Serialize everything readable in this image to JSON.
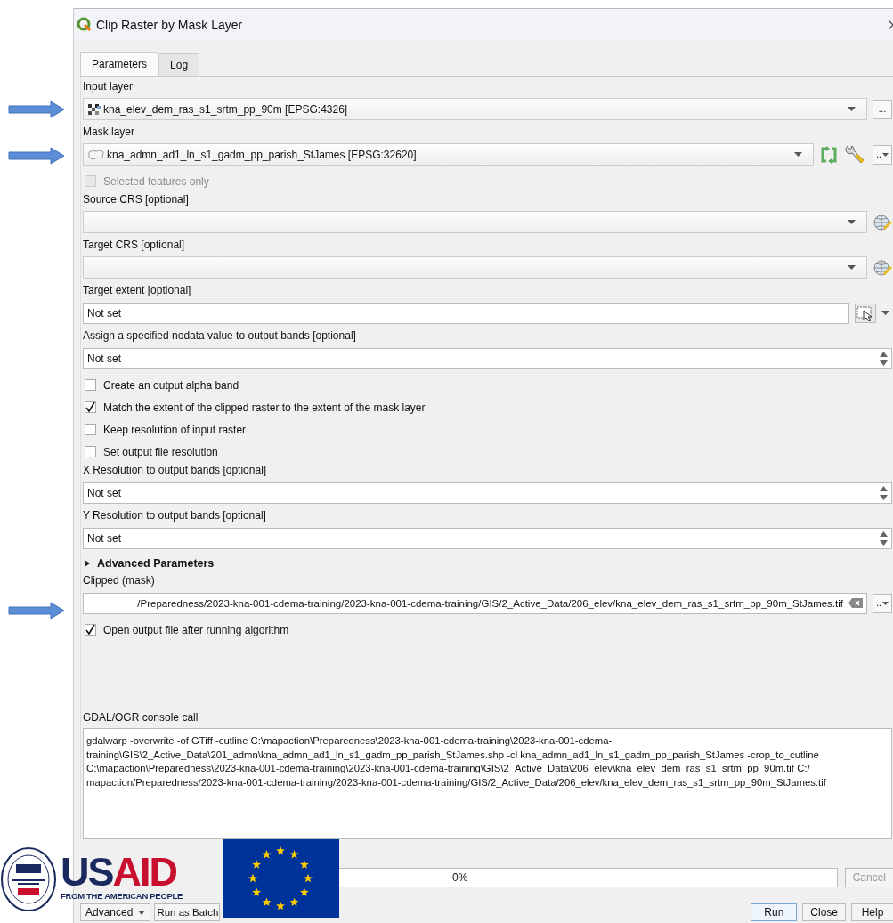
{
  "window": {
    "title": "Clip Raster by Mask Layer"
  },
  "tabs": [
    {
      "label": "Parameters",
      "selected": true
    },
    {
      "label": "Log",
      "selected": false
    }
  ],
  "parameters": [
    {
      "kind": "raster_layer",
      "label": "Input layer",
      "value": "kna_elev_dem_ras_s1_srtm_pp_90m [EPSG:4326]",
      "button": "..."
    },
    {
      "kind": "vector_layer",
      "label": "Mask layer",
      "value": "kna_admn_ad1_ln_s1_gadm_pp_parish_StJames [EPSG:32620]",
      "button": ".."
    },
    {
      "kind": "checkbox",
      "label": "Selected features only",
      "checked": false,
      "disabled": true
    },
    {
      "kind": "crs",
      "label": "Source CRS [optional]"
    },
    {
      "kind": "crs",
      "label": "Target CRS [optional]"
    },
    {
      "kind": "extent",
      "label": "Target extent [optional]",
      "value": "Not set"
    },
    {
      "kind": "spin",
      "label": "Assign a specified nodata value to output bands [optional]",
      "value": "Not set"
    },
    {
      "kind": "checkbox",
      "label": "Create an output alpha band",
      "checked": false,
      "disabled": false
    },
    {
      "kind": "checkbox",
      "label": "Match the extent of the clipped raster to the extent of the mask layer",
      "checked": true,
      "disabled": false
    },
    {
      "kind": "checkbox",
      "label": "Keep resolution of input raster",
      "checked": false,
      "disabled": false
    },
    {
      "kind": "checkbox",
      "label": "Set output file resolution",
      "checked": false,
      "disabled": false
    },
    {
      "kind": "spin",
      "label": "X Resolution to output bands [optional]",
      "value": "Not set"
    },
    {
      "kind": "spin",
      "label": "Y Resolution to output bands [optional]",
      "value": "Not set"
    },
    {
      "kind": "section",
      "label": "Advanced Parameters",
      "expanded": false
    },
    {
      "kind": "output",
      "label": "Clipped (mask)",
      "value": "/Preparedness/2023-kna-001-cdema-training/2023-kna-001-cdema-training/GIS/2_Active_Data/206_elev/kna_elev_dem_ras_s1_srtm_pp_90m_StJames.tif",
      "button": ".."
    },
    {
      "kind": "checkbox",
      "label": "Open output file after running algorithm",
      "checked": true,
      "disabled": false
    }
  ],
  "console": {
    "label": "GDAL/OGR console call",
    "lines": [
      "gdalwarp -overwrite -of GTiff -cutline C:\\mapaction\\Preparedness\\2023-kna-001-cdema-training\\2023-kna-001-cdema-",
      "training\\GIS\\2_Active_Data\\201_admn\\kna_admn_ad1_ln_s1_gadm_pp_parish_StJames.shp -cl kna_admn_ad1_ln_s1_gadm_pp_parish_StJames -crop_to_cutline",
      "C:\\mapaction\\Preparedness\\2023-kna-001-cdema-training\\2023-kna-001-cdema-training\\GIS\\2_Active_Data\\206_elev\\kna_elev_dem_ras_s1_srtm_pp_90m.tif C:/",
      "mapaction/Preparedness/2023-kna-001-cdema-training/2023-kna-001-cdema-training/GIS/2_Active_Data/206_elev/kna_elev_dem_ras_s1_srtm_pp_90m_StJames.tif"
    ]
  },
  "progress": {
    "level": 0,
    "text": "0%",
    "cancel": "Cancel",
    "cancel_disabled": true
  },
  "buttons": [
    {
      "label": "Advanced",
      "kind": "menu"
    },
    {
      "label": "Run as Batch",
      "kind": "left"
    },
    {
      "label": "Run",
      "kind": "default"
    },
    {
      "label": "Close",
      "kind": "right"
    },
    {
      "label": "Help",
      "kind": "right"
    }
  ],
  "logo": {
    "part_1": "US",
    "part_2": "AID",
    "tagline": "FROM THE AMERICAN PEOPLE"
  }
}
